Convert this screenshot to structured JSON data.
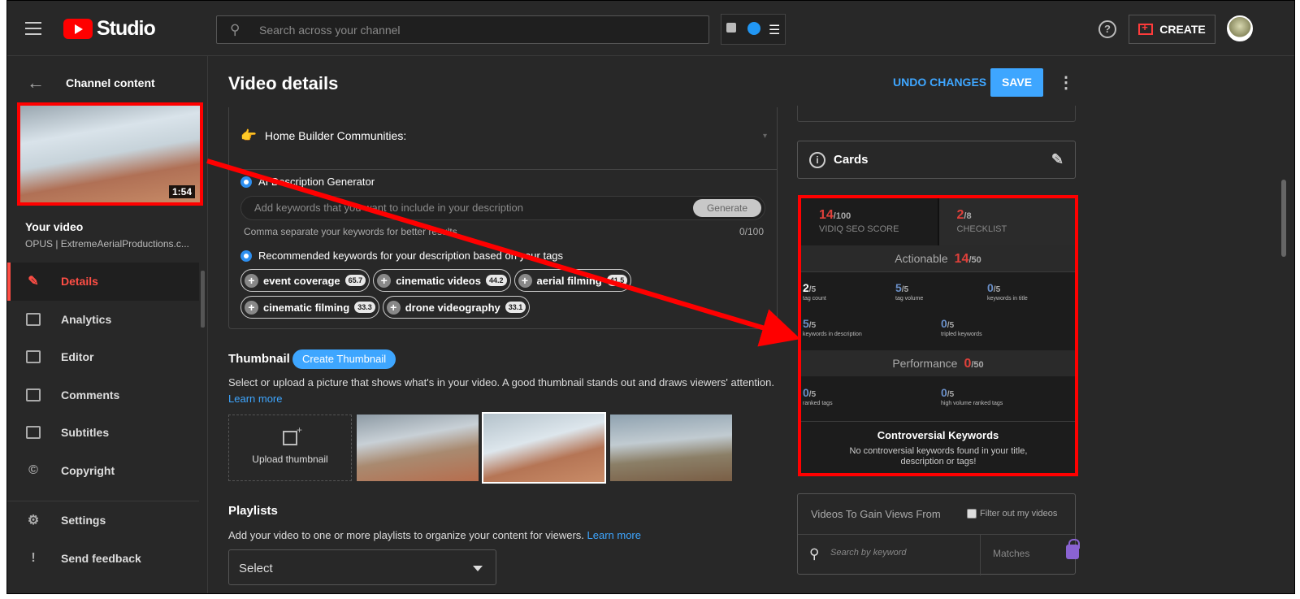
{
  "topbar": {
    "studio_label": "Studio",
    "search_placeholder": "Search across your channel",
    "create_label": "CREATE",
    "help_label": "?"
  },
  "sidebar": {
    "back_label": "Channel content",
    "thumbnail_duration": "1:54",
    "your_video_label": "Your video",
    "video_subtitle": "OPUS | ExtremeAerialProductions.c...",
    "items": [
      {
        "label": "Details",
        "icon": "pencil-icon"
      },
      {
        "label": "Analytics",
        "icon": "analytics-icon"
      },
      {
        "label": "Editor",
        "icon": "editor-icon"
      },
      {
        "label": "Comments",
        "icon": "comments-icon"
      },
      {
        "label": "Subtitles",
        "icon": "subtitles-icon"
      },
      {
        "label": "Copyright",
        "icon": "copyright-icon"
      }
    ],
    "bottom_items": [
      {
        "label": "Settings",
        "icon": "gear-icon"
      },
      {
        "label": "Send feedback",
        "icon": "feedback-icon"
      }
    ]
  },
  "header": {
    "title": "Video details",
    "undo_label": "UNDO CHANGES",
    "save_label": "SAVE"
  },
  "description": {
    "home_builder_line": "Home Builder Communities:",
    "ai_generator_label": "AI Description Generator",
    "keywords_placeholder": "Add keywords that you want to include in your description",
    "generate_label": "Generate",
    "hint": "Comma separate your keywords for better results",
    "counter": "0/100",
    "recommended_label": "Recommended keywords for your description based on your tags",
    "chips": [
      {
        "label": "event coverage",
        "score": "65.7"
      },
      {
        "label": "cinematic videos",
        "score": "44.2"
      },
      {
        "label": "aerial filming",
        "score": "41.5"
      },
      {
        "label": "cinematic filming",
        "score": "33.3"
      },
      {
        "label": "drone videography",
        "score": "33.1"
      }
    ]
  },
  "thumbnail": {
    "title": "Thumbnail",
    "create_label": "Create Thumbnail",
    "description": "Select or upload a picture that shows what's in your video. A good thumbnail stands out and draws viewers' attention.",
    "learn_more": "Learn more",
    "upload_label": "Upload thumbnail"
  },
  "playlists": {
    "title": "Playlists",
    "description": "Add your video to one or more playlists to organize your content for viewers.",
    "learn_more": "Learn more",
    "select_value": "Select"
  },
  "cards": {
    "label": "Cards"
  },
  "seo_panel": {
    "score_value": "14",
    "score_max": "/100",
    "score_caption": "VIDIQ SEO SCORE",
    "checklist_value": "2",
    "checklist_max": "/8",
    "checklist_caption": "CHECKLIST",
    "actionable_label": "Actionable",
    "actionable_value": "14",
    "actionable_max": "/50",
    "metrics_actionable": [
      {
        "value": "2",
        "max": "/5",
        "label": "tag count",
        "color": "white"
      },
      {
        "value": "5",
        "max": "/5",
        "label": "tag volume",
        "color": "blue"
      },
      {
        "value": "0",
        "max": "/5",
        "label": "keywords in title",
        "color": "blue"
      },
      {
        "value": "5",
        "max": "/5",
        "label": "keywords in description",
        "color": "blue"
      },
      {
        "value": "0",
        "max": "/5",
        "label": "tripled keywords",
        "color": "blue"
      }
    ],
    "performance_label": "Performance",
    "performance_value": "0",
    "performance_max": "/50",
    "metrics_performance": [
      {
        "value": "0",
        "max": "/5",
        "label": "ranked tags",
        "color": "blue"
      },
      {
        "value": "0",
        "max": "/5",
        "label": "high volume ranked tags",
        "color": "blue"
      }
    ],
    "controversial_title": "Controversial Keywords",
    "controversial_text": "No controversial keywords found in your title, description or tags!"
  },
  "views_panel": {
    "title": "Videos To Gain Views From",
    "filter_label": "Filter out my videos",
    "search_placeholder": "Search by keyword",
    "matches_label": "Matches"
  },
  "colors": {
    "accent_blue": "#3ea6ff",
    "brand_red": "#ff0000",
    "annotation_red": "#ff0000",
    "score_red": "#e0403a"
  }
}
